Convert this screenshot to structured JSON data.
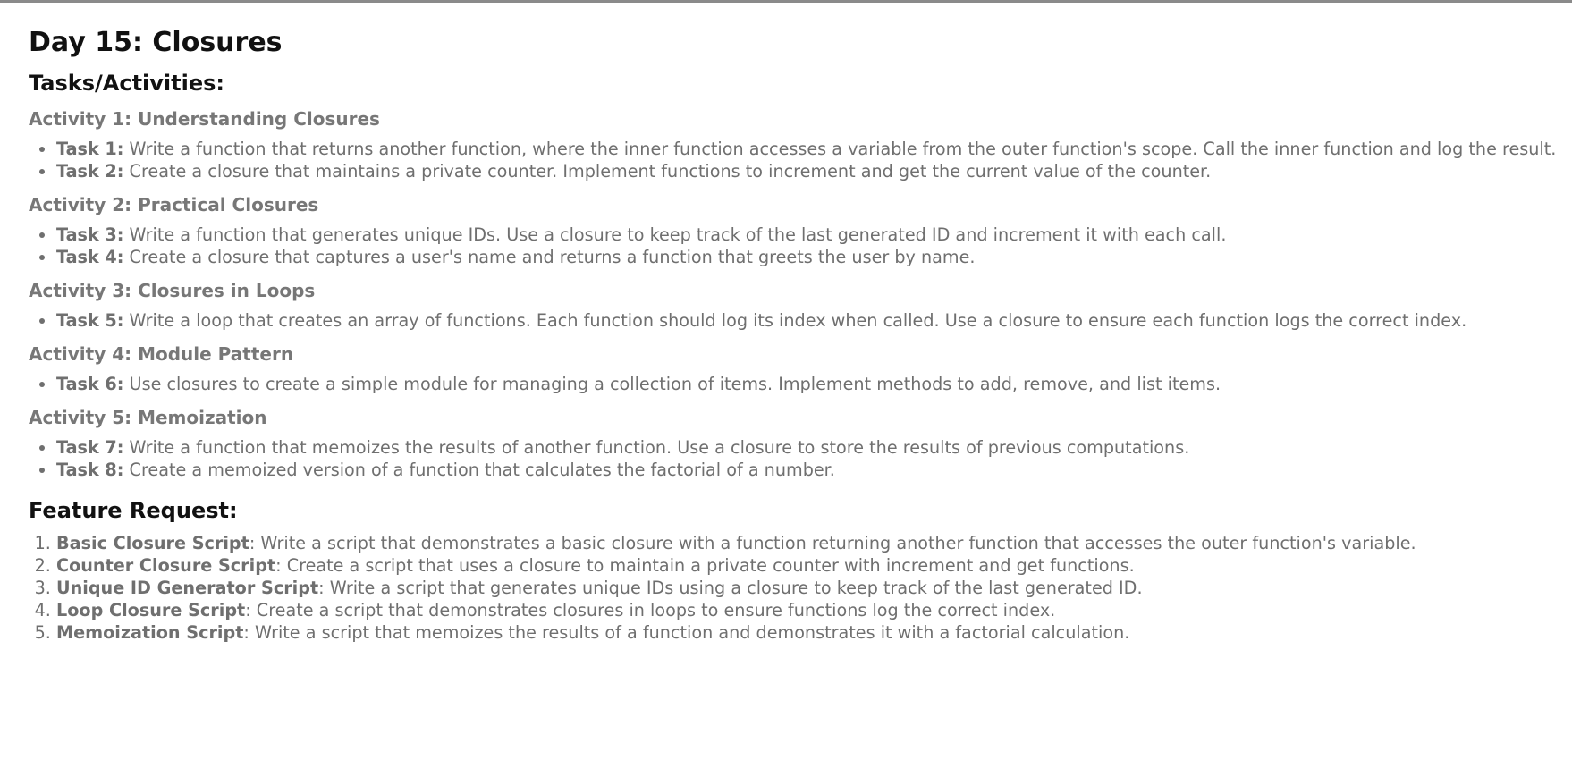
{
  "title": "Day 15: Closures",
  "tasks_heading": "Tasks/Activities:",
  "activities": [
    {
      "heading": "Activity 1: Understanding Closures",
      "tasks": [
        {
          "label": "Task 1:",
          "text": " Write a function that returns another function, where the inner function accesses a variable from the outer function's scope. Call the inner function and log the result."
        },
        {
          "label": "Task 2:",
          "text": " Create a closure that maintains a private counter. Implement functions to increment and get the current value of the counter."
        }
      ]
    },
    {
      "heading": "Activity 2: Practical Closures",
      "tasks": [
        {
          "label": "Task 3:",
          "text": " Write a function that generates unique IDs. Use a closure to keep track of the last generated ID and increment it with each call."
        },
        {
          "label": "Task 4:",
          "text": " Create a closure that captures a user's name and returns a function that greets the user by name."
        }
      ]
    },
    {
      "heading": "Activity 3: Closures in Loops",
      "tasks": [
        {
          "label": "Task 5:",
          "text": " Write a loop that creates an array of functions. Each function should log its index when called. Use a closure to ensure each function logs the correct index."
        }
      ]
    },
    {
      "heading": "Activity 4: Module Pattern",
      "tasks": [
        {
          "label": "Task 6:",
          "text": " Use closures to create a simple module for managing a collection of items. Implement methods to add, remove, and list items."
        }
      ]
    },
    {
      "heading": "Activity 5: Memoization",
      "tasks": [
        {
          "label": "Task 7:",
          "text": " Write a function that memoizes the results of another function. Use a closure to store the results of previous computations."
        },
        {
          "label": "Task 8:",
          "text": " Create a memoized version of a function that calculates the factorial of a number."
        }
      ]
    }
  ],
  "feature_heading": "Feature Request:",
  "features": [
    {
      "label": "Basic Closure Script",
      "text": ": Write a script that demonstrates a basic closure with a function returning another function that accesses the outer function's variable."
    },
    {
      "label": "Counter Closure Script",
      "text": ": Create a script that uses a closure to maintain a private counter with increment and get functions."
    },
    {
      "label": "Unique ID Generator Script",
      "text": ": Write a script that generates unique IDs using a closure to keep track of the last generated ID."
    },
    {
      "label": "Loop Closure Script",
      "text": ": Create a script that demonstrates closures in loops to ensure functions log the correct index."
    },
    {
      "label": "Memoization Script",
      "text": ": Write a script that memoizes the results of a function and demonstrates it with a factorial calculation."
    }
  ]
}
